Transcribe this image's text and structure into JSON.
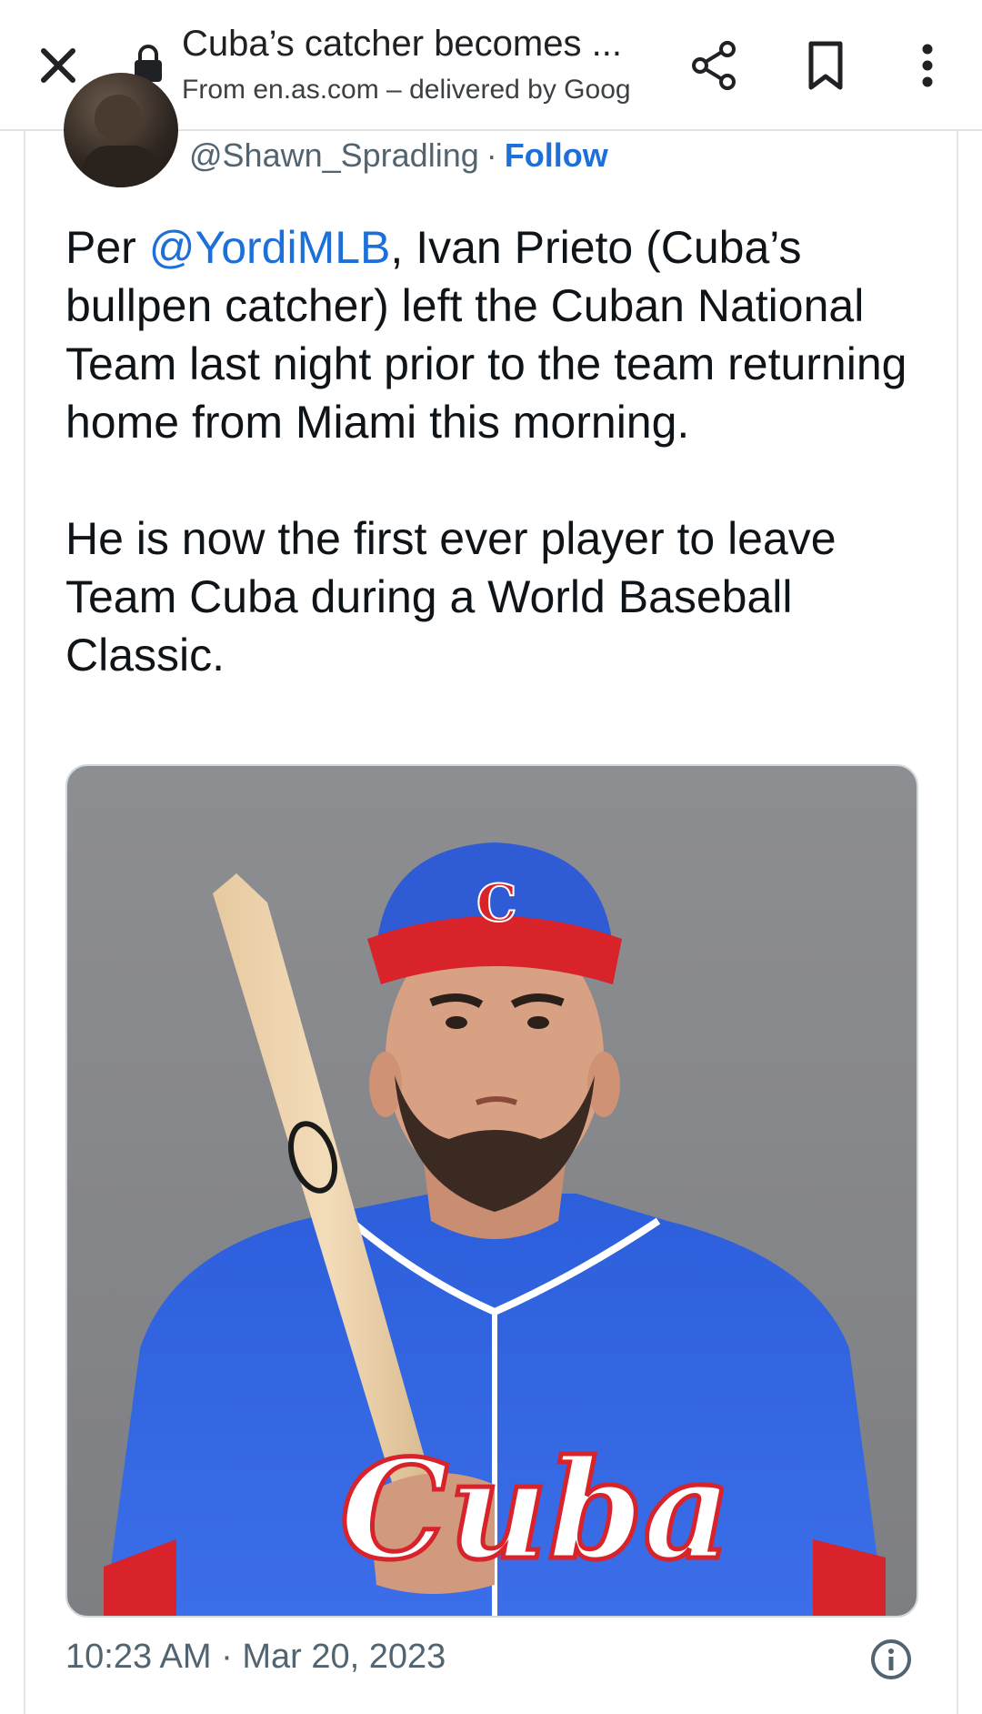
{
  "browser": {
    "title": "Cuba’s catcher becomes ...",
    "subtitle": "From en.as.com – delivered by Goog",
    "icons": [
      "close-icon",
      "lock-icon",
      "share-icon",
      "bookmark-icon",
      "more-vert-icon"
    ]
  },
  "tweet": {
    "handle": "@Shawn_Spradling",
    "separator": "·",
    "follow_label": "Follow",
    "p1_before": "Per ",
    "p1_mention": "@YordiMLB",
    "p1_after": ", Ivan Prieto (Cuba’s bullpen catcher) left the Cuban National Team last night prior to the team returning home from Miami this morning.",
    "p2": "He is now the first ever player to leave Team Cuba during a World Baseball Classic.",
    "timestamp": "10:23 AM · Mar 20, 2023",
    "photo_jersey_text": "Cuba",
    "photo_cap_letter": "C"
  },
  "colors": {
    "link": "#1d6fd9",
    "text": "#0f1419",
    "muted": "#536471",
    "jersey_blue": "#2a5bd6",
    "cap_red": "#d8232a"
  }
}
